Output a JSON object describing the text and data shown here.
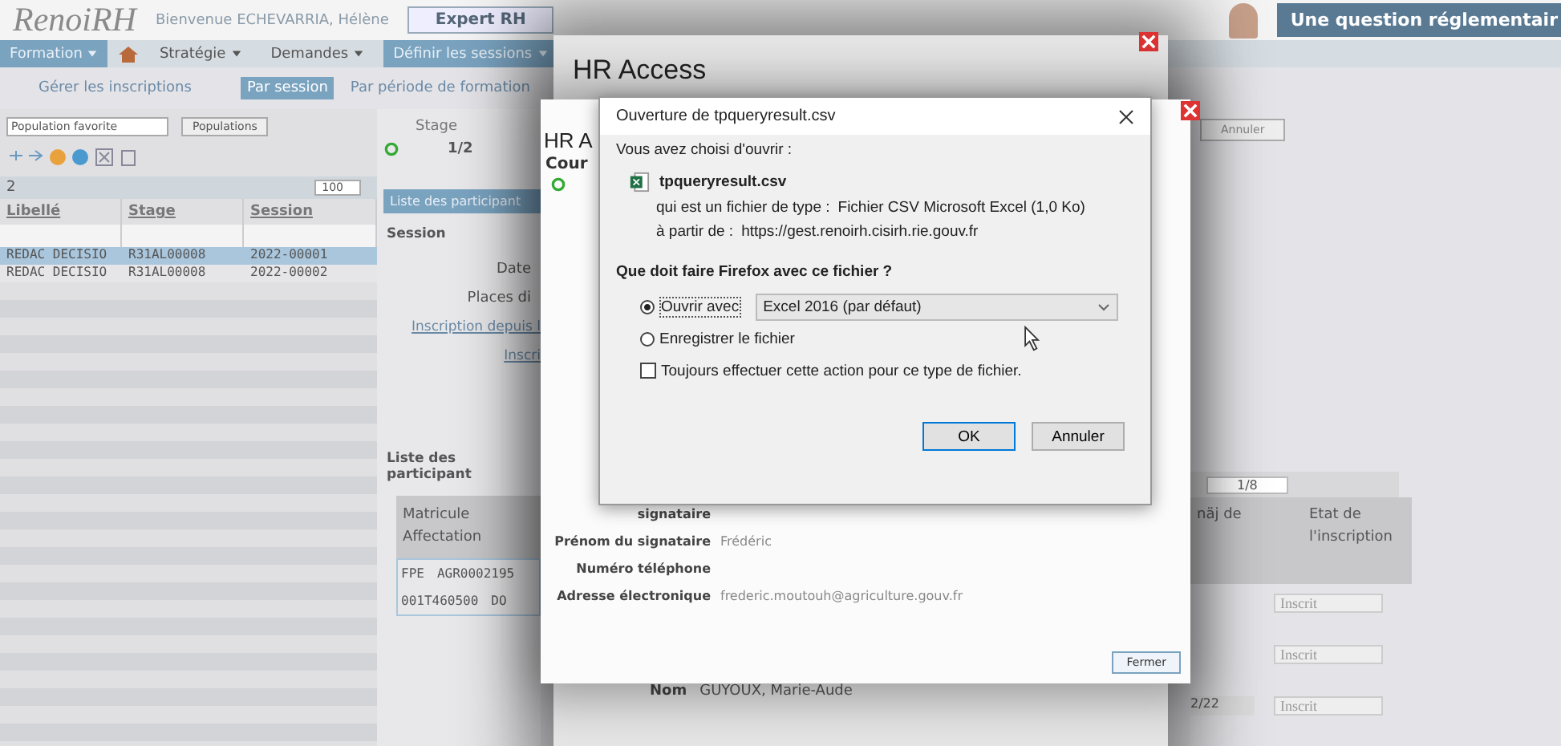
{
  "header": {
    "logo": "RenoiRH",
    "welcome": "Bienvenue ECHEVARRIA, Hélène",
    "role_tab": "Expert RH",
    "help": "Une question réglementair"
  },
  "menu": [
    {
      "label": "Formation",
      "selected": true,
      "dropdown": true
    },
    {
      "label": "Stratégie",
      "selected": false,
      "dropdown": true
    },
    {
      "label": "Demandes",
      "selected": false,
      "dropdown": true
    },
    {
      "label": "Définir les sessions",
      "selected": true,
      "dropdown": true
    }
  ],
  "breadcrumb": {
    "title": "Gérer les inscriptions",
    "steps": [
      {
        "label": "Par session",
        "selected": true
      },
      {
        "label": "Par période de formation",
        "selected": false
      }
    ]
  },
  "left_panel": {
    "population": "Population favorite",
    "populations_button": "Populations",
    "count": "2",
    "page_size": "100",
    "columns": [
      "Libellé",
      "Stage",
      "Session"
    ],
    "rows": [
      {
        "cells": [
          "REDAC DECISIO",
          "R31AL00008",
          "2022-00001"
        ],
        "selected": true
      },
      {
        "cells": [
          "REDAC DECISIO",
          "R31AL00008",
          "2022-00002"
        ],
        "selected": false
      }
    ]
  },
  "session_panel": {
    "stage_label": "Stage",
    "pager": "1/2",
    "tab": "Liste des participant",
    "section": "Session",
    "fields": [
      "Date",
      "Places di"
    ],
    "links": [
      "Inscription depuis l",
      "Inscri"
    ],
    "participants_section": "Liste des participant",
    "table_headers": [
      "Matricule",
      "Affectation"
    ],
    "cells": [
      "FPE",
      "AGR0002195"
    ],
    "sub_cells": [
      "001T460500",
      "DO"
    ]
  },
  "right_area": {
    "cancel_button": "Annuler",
    "pager": "1/8",
    "headers": [
      "näj de",
      "Etat de l'inscription"
    ],
    "date": "2/22",
    "statuses": [
      "Inscrit",
      "Inscrit",
      "Inscrit"
    ]
  },
  "hr_window_back": {
    "title": "HR Access",
    "name_label": "Nom",
    "name_value": "GUYOUX, Marie-Aude"
  },
  "hr_window_front": {
    "title": "HR A",
    "section": "Cour",
    "fields": [
      {
        "label": "signataire"
      },
      {
        "label": "Prénom du signataire",
        "value": "Frédéric"
      },
      {
        "label": "Numéro téléphone"
      },
      {
        "label": "Adresse électronique",
        "value": "frederic.moutouh@agriculture.gouv.fr"
      }
    ],
    "close_button": "Fermer"
  },
  "download_dialog": {
    "title": "Ouverture de tpqueryresult.csv",
    "intro": "Vous avez choisi d'ouvrir :",
    "file_name": "tpqueryresult.csv",
    "type_label": "qui est un fichier de type :",
    "type_value": "Fichier CSV Microsoft Excel (1,0 Ko)",
    "from_label": "à partir de :",
    "from_value": "https://gest.renoirh.cisirh.rie.gouv.fr",
    "question": "Que doit faire Firefox avec ce fichier ?",
    "options": [
      {
        "label": "Ouvrir avec",
        "selected": true
      },
      {
        "label": "Enregistrer le fichier",
        "selected": false
      }
    ],
    "app_select": "Excel 2016 (par défaut)",
    "always_checkbox": {
      "label": "Toujours effectuer cette action pour ce type de fichier.",
      "checked": false
    },
    "buttons": [
      "OK",
      "Annuler"
    ]
  }
}
